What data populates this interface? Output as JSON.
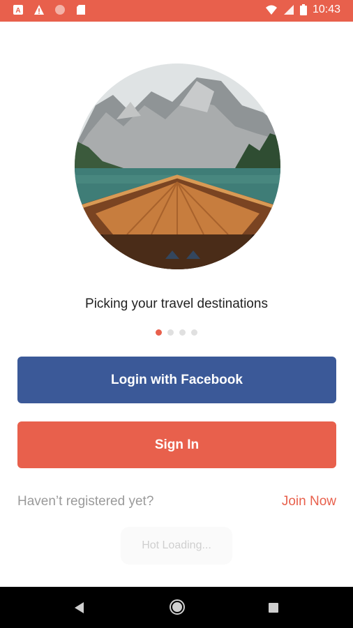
{
  "status_bar": {
    "time": "10:43",
    "icons": [
      "a-icon",
      "warning-icon",
      "circle-icon",
      "sd-card-icon",
      "wifi-icon",
      "signal-icon",
      "battery-icon"
    ],
    "bg_color": "#e8604c"
  },
  "onboarding": {
    "caption": "Picking your travel destinations",
    "page_count": 4,
    "active_page": 1
  },
  "actions": {
    "facebook_label": "Login with Facebook",
    "signin_label": "Sign In"
  },
  "register": {
    "prompt": "Haven’t registered yet?",
    "join_label": "Join Now"
  },
  "toast": {
    "text": "Hot Loading..."
  },
  "colors": {
    "accent": "#e8604c",
    "facebook": "#3b5998"
  }
}
